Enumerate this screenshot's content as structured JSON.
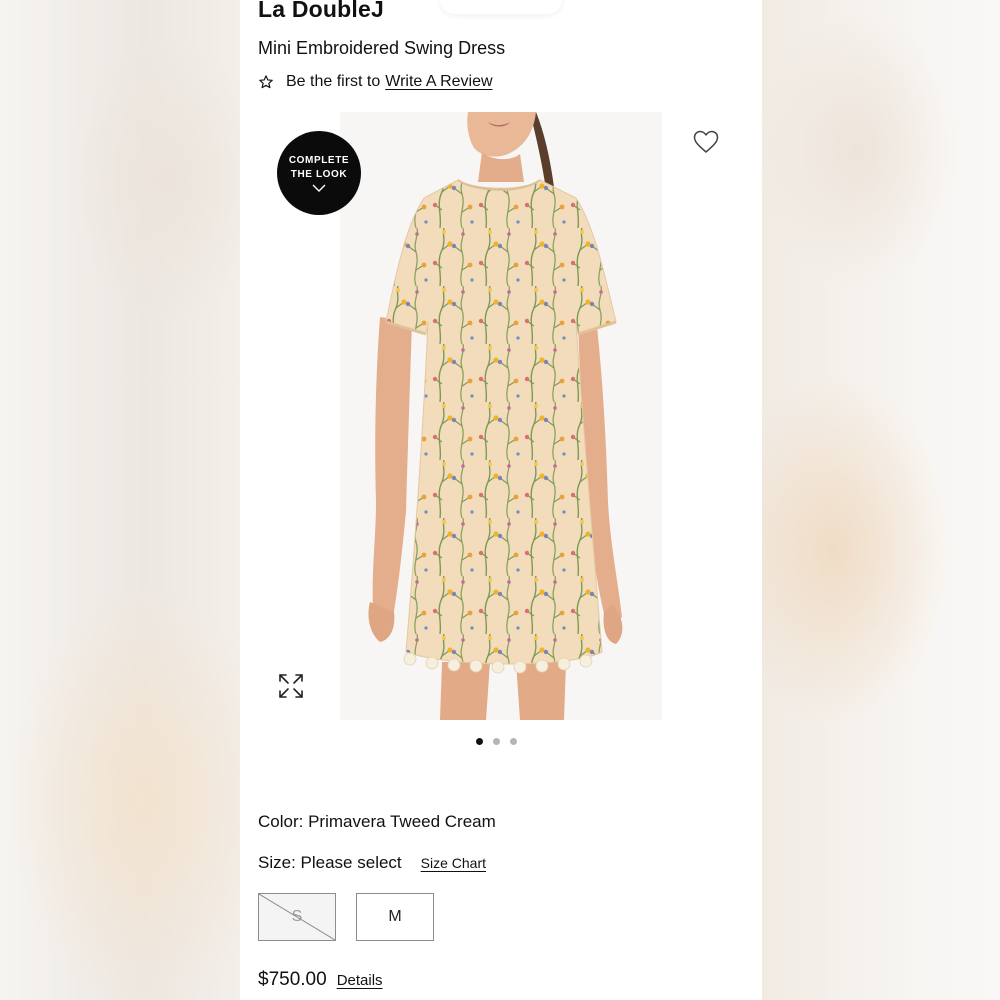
{
  "product": {
    "brand": "La DoubleJ",
    "name": "Mini Embroidered Swing Dress",
    "review_prefix": "Be the first to",
    "review_link": "Write A Review",
    "image_alt": "Mini Embroidered Swing Dress product photo"
  },
  "gallery": {
    "badge_line1": "COMPLETE",
    "badge_line2": "THE LOOK",
    "total_images": 3,
    "active_index": 0,
    "icons": {
      "wishlist": "heart-icon",
      "expand": "expand-icon",
      "badge": "chevron-down-icon",
      "review": "star-icon"
    }
  },
  "options": {
    "color_label": "Color:",
    "color_value": "Primavera Tweed Cream",
    "size_label": "Size:",
    "size_value": "Please select",
    "size_chart": "Size Chart",
    "sizes": [
      {
        "label": "S",
        "available": false
      },
      {
        "label": "M",
        "available": true
      }
    ]
  },
  "pricing": {
    "price": "$750.00",
    "details_link": "Details"
  },
  "colors": {
    "dress_base": "#f2d9b8",
    "badge_bg": "#0b0b0b",
    "dot_active": "#111111",
    "dot_inactive": "#b5b5b5"
  }
}
